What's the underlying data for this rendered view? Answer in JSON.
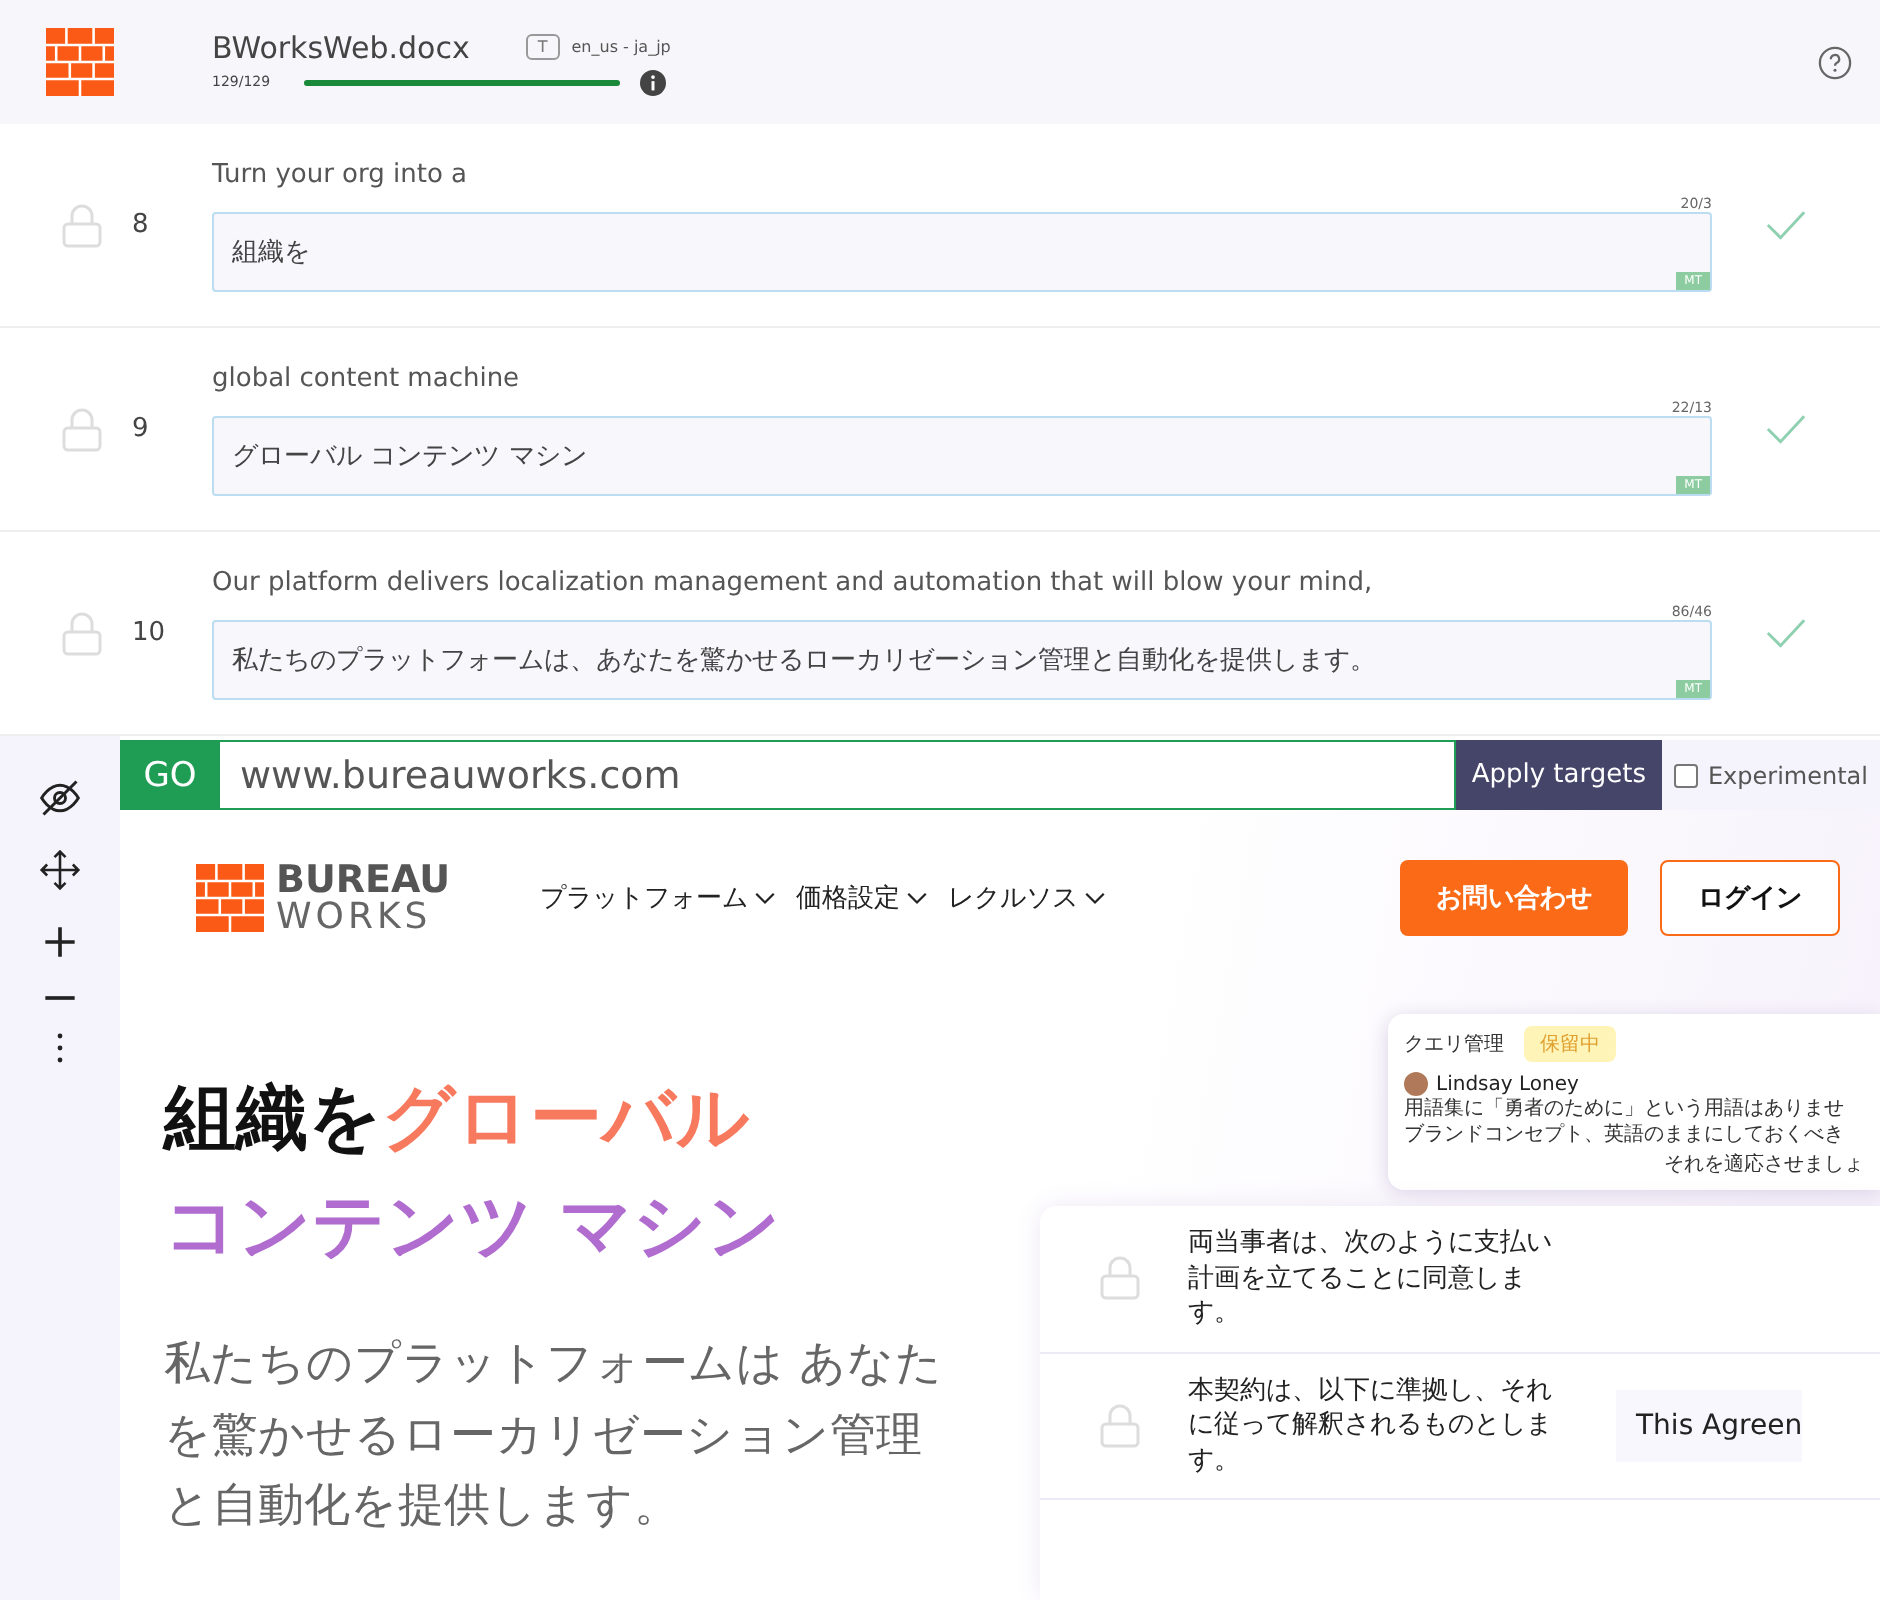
{
  "header": {
    "file_name": "BWorksWeb.docx",
    "lang_badge": "T",
    "language_pair": "en_us - ja_jp",
    "progress_text": "129/129",
    "progress": {
      "level": 1
    }
  },
  "segments": [
    {
      "number": "8",
      "source": "Turn your org into a",
      "counter": "20/3",
      "target": "組織を",
      "badge": "MT"
    },
    {
      "number": "9",
      "source": "global content machine",
      "counter": "22/13",
      "target": "グローバル コンテンツ マシン",
      "badge": "MT"
    },
    {
      "number": "10",
      "source": "Our platform delivers localization management and automation that will blow your mind,",
      "counter": "86/46",
      "target": "私たちのプラットフォームは、あなたを驚かせるローカリゼーション管理と自動化を提供します。",
      "badge": "MT"
    }
  ],
  "url_bar": {
    "go": "GO",
    "url": "www.bureauworks.com",
    "apply": "Apply targets",
    "experimental": {
      "label": "Experimental",
      "checked": false
    }
  },
  "preview": {
    "logo_text": [
      "BUREAU",
      "WORKS"
    ],
    "nav": [
      "プラットフォーム",
      "価格設定",
      "レクルソス"
    ],
    "contact_button": "お問い合わせ",
    "login_button": "ログイン",
    "hero_title": [
      {
        "text": "組織を",
        "color": "#111111"
      },
      {
        "text": "グローバル",
        "color": "#f7795e"
      },
      {
        "text": "コンテンツ マシン",
        "color": "#b06ccf"
      }
    ],
    "hero_subtitle": "私たちのプラットフォームは あなたを驚かせるローカリゼーション管理と自動化を提供します。",
    "query": {
      "title": "クエリ管理",
      "status": "保留中",
      "user": "Lindsay Loney",
      "comment_lines": [
        "用語集に「勇者のために」という用語はありませ",
        "ブランドコンセプト、英語のままにしておくべき"
      ],
      "action": "それを適応させましょ"
    },
    "card_rows": [
      "両当事者は、次のように支払い計画を立てることに同意します。",
      "本契約は、以下に準拠し、それに従って解釈されるものとします。"
    ],
    "agreement": "This Agreen"
  }
}
